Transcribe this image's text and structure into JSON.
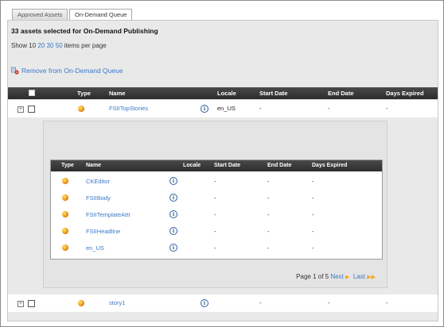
{
  "tabs": [
    {
      "label": "Approved Assets",
      "active": false
    },
    {
      "label": "On-Demand Queue",
      "active": true
    }
  ],
  "selection_summary": "33 assets selected for On-Demand Publishing",
  "per_page": {
    "prefix": "Show 10",
    "opt20": "20",
    "opt30": "30",
    "opt50": "50",
    "suffix": "items per page"
  },
  "remove_label": "Remove from On-Demand Queue",
  "columns": {
    "type": "Type",
    "name": "Name",
    "locale": "Locale",
    "start": "Start Date",
    "end": "End Date",
    "days": "Days Expired"
  },
  "rows": [
    {
      "name": "FSIITopStories",
      "locale": "en_US",
      "start": "-",
      "end": "-",
      "days": "-"
    },
    {
      "name": "story1",
      "locale": "",
      "start": "-",
      "end": "-",
      "days": "-"
    }
  ],
  "inner_columns": {
    "type": "Type",
    "name": "Name",
    "locale": "Locale",
    "start": "Start Date",
    "end": "End Date",
    "days": "Days Expired"
  },
  "inner_rows": [
    {
      "name": "CKEditor",
      "start": "-",
      "end": "-",
      "days": "-"
    },
    {
      "name": "FSIIBody",
      "start": "-",
      "end": "-",
      "days": "-"
    },
    {
      "name": "FSIITemplateAttr",
      "start": "-",
      "end": "-",
      "days": "-"
    },
    {
      "name": "FSIIHeadline",
      "start": "-",
      "end": "-",
      "days": "-"
    },
    {
      "name": "en_US",
      "start": "-",
      "end": "-",
      "days": "-"
    }
  ],
  "pager": {
    "text": "Page 1 of 5",
    "next": "Next",
    "last": "Last"
  },
  "colors": {
    "link": "#3a7ac8",
    "header": "#333333",
    "accent": "#f5a623"
  },
  "icons": {
    "expand": "expand-plus-icon",
    "asset": "asset-ball-icon",
    "info": "info-icon",
    "remove": "remove-queue-icon"
  }
}
